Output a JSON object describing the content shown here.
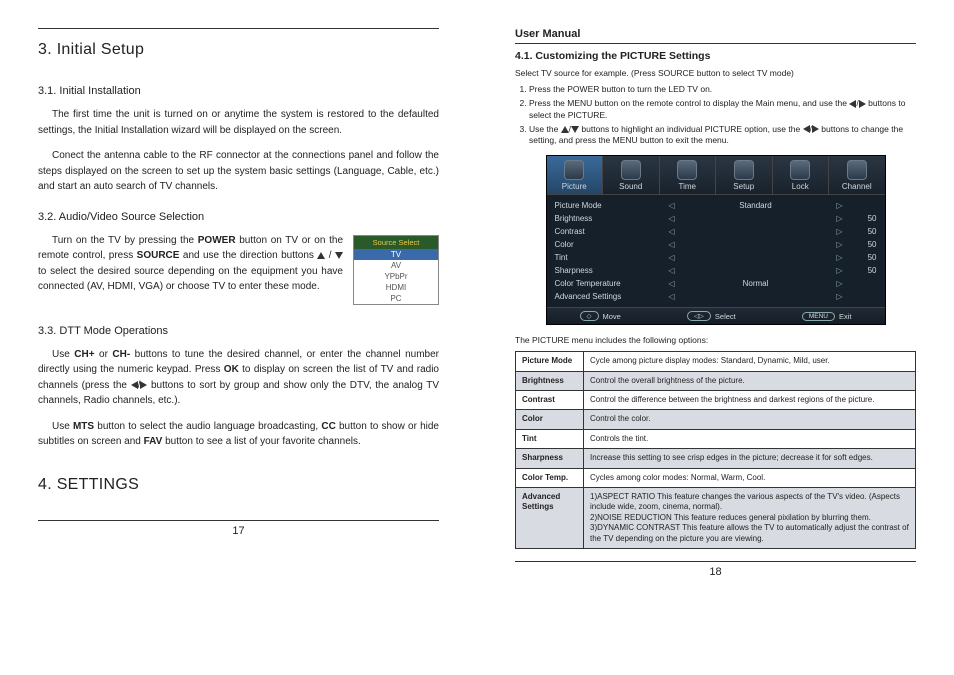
{
  "leftPage": {
    "h1": "3. Initial Setup",
    "s31": "3.1.  Initial Installation",
    "p31a": "The first time the unit is turned on or anytime the system is restored to the defaulted settings, the Initial Installation wizard will be displayed on the screen.",
    "p31b": "Conect the antenna cable to the RF connector at the connections panel and follow the steps displayed on the screen to set up the system basic settings (Language, Cable, etc.) and start an auto search of TV channels.",
    "s32": "3.2.  Audio/Video Source Selection",
    "p32a_1": "Turn on the TV by pressing the ",
    "p32a_2": " button on TV or on the remote control, press ",
    "p32a_3": " and use the direction buttons ",
    "p32a_4": " to select the desired source depending on the equipment you have connected (AV, HDMI, VGA) or choose TV to enter these mode.",
    "power_lbl": "POWER",
    "source_lbl": "SOURCE",
    "s33": "3.3.  DTT Mode Operations",
    "p33a_1": "Use ",
    "p33a_2": " or ",
    "p33a_3": " buttons to tune the desired channel, or enter the channel number directly using the numeric keypad. Press ",
    "p33a_4": " to display on screen the list of TV and radio channels (press the ",
    "p33a_5": " buttons to sort by group and show only the DTV, the analog TV channels, Radio channels, etc.).",
    "chp": "CH+",
    "chm": "CH-",
    "ok": "OK",
    "p33b_1": "Use ",
    "p33b_2": " button to select the audio language broadcasting, ",
    "p33b_3": " button  to show or hide subtitles on screen and ",
    "p33b_4": " button to see a list of your favorite channels.",
    "mts": "MTS",
    "cc": "CC",
    "fav": "FAV",
    "h4": "4. SETTINGS",
    "pagenum": "17",
    "srcbox": {
      "hdr": "Source Select",
      "sel": "TV",
      "o1": "AV",
      "o2": "YPbPr",
      "o3": "HDMI",
      "o4": "PC"
    }
  },
  "rightPage": {
    "um": "User Manual",
    "h41": "4.1. Customizing the PICTURE Settings",
    "intro": "Select TV source for example. (Press SOURCE button to select TV mode)",
    "li1": "Press the POWER button to turn the LED TV on.",
    "li2_a": "Press the MENU button on the remote control to display the Main menu, and use the ",
    "li2_b": " buttons to select the PICTURE.",
    "li3_a": "Use the ",
    "li3_b": " buttons to highlight an individual PICTURE option, use the ",
    "li3_c": " buttons to change the setting, and press the MENU button to exit the menu.",
    "osd": {
      "tabs": [
        "Picture",
        "Sound",
        "Time",
        "Setup",
        "Lock",
        "Channel"
      ],
      "rows": [
        {
          "lab": "Picture Mode",
          "val": "Standard",
          "num": ""
        },
        {
          "lab": "Brightness",
          "val": "",
          "num": "50"
        },
        {
          "lab": "Contrast",
          "val": "",
          "num": "50"
        },
        {
          "lab": "Color",
          "val": "",
          "num": "50"
        },
        {
          "lab": "Tint",
          "val": "",
          "num": "50"
        },
        {
          "lab": "Sharpness",
          "val": "",
          "num": "50"
        },
        {
          "lab": "Color Temperature",
          "val": "Normal",
          "num": ""
        },
        {
          "lab": "Advanced Settings",
          "val": "",
          "num": ""
        }
      ],
      "foot": {
        "move": "Move",
        "select": "Select",
        "menu": "MENU",
        "exit": "Exit"
      }
    },
    "optintro": "The PICTURE menu includes the following options:",
    "opts": [
      {
        "k": "Picture Mode",
        "v": "Cycle among picture display modes: Standard, Dynamic, Mild, user.",
        "shade": false
      },
      {
        "k": "Brightness",
        "v": "Control the overall brightness of the picture.",
        "shade": true
      },
      {
        "k": "Contrast",
        "v": "Control the difference between the brightness and darkest regions of the picture.",
        "shade": false
      },
      {
        "k": "Color",
        "v": "Control the color.",
        "shade": true
      },
      {
        "k": "Tint",
        "v": "Controls the tint.",
        "shade": false
      },
      {
        "k": "Sharpness",
        "v": "Increase this setting to see crisp edges in the picture; decrease it for soft edges.",
        "shade": true
      },
      {
        "k": "Color Temp.",
        "v": "Cycles among color modes: Normal, Warm, Cool.",
        "shade": false
      },
      {
        "k": "Advanced Settings",
        "v": "1)ASPECT RATIO This feature changes the various aspects of the TV's video. (Aspects include wide, zoom, cinema, normal).\n2)NOISE REDUCTION This feature reduces general pixilation by blurring them.\n3)DYNAMIC CONTRAST This feature allows the TV to automatically adjust the contrast of the TV depending on the picture you are viewing.",
        "shade": true
      }
    ],
    "pagenum": "18"
  }
}
